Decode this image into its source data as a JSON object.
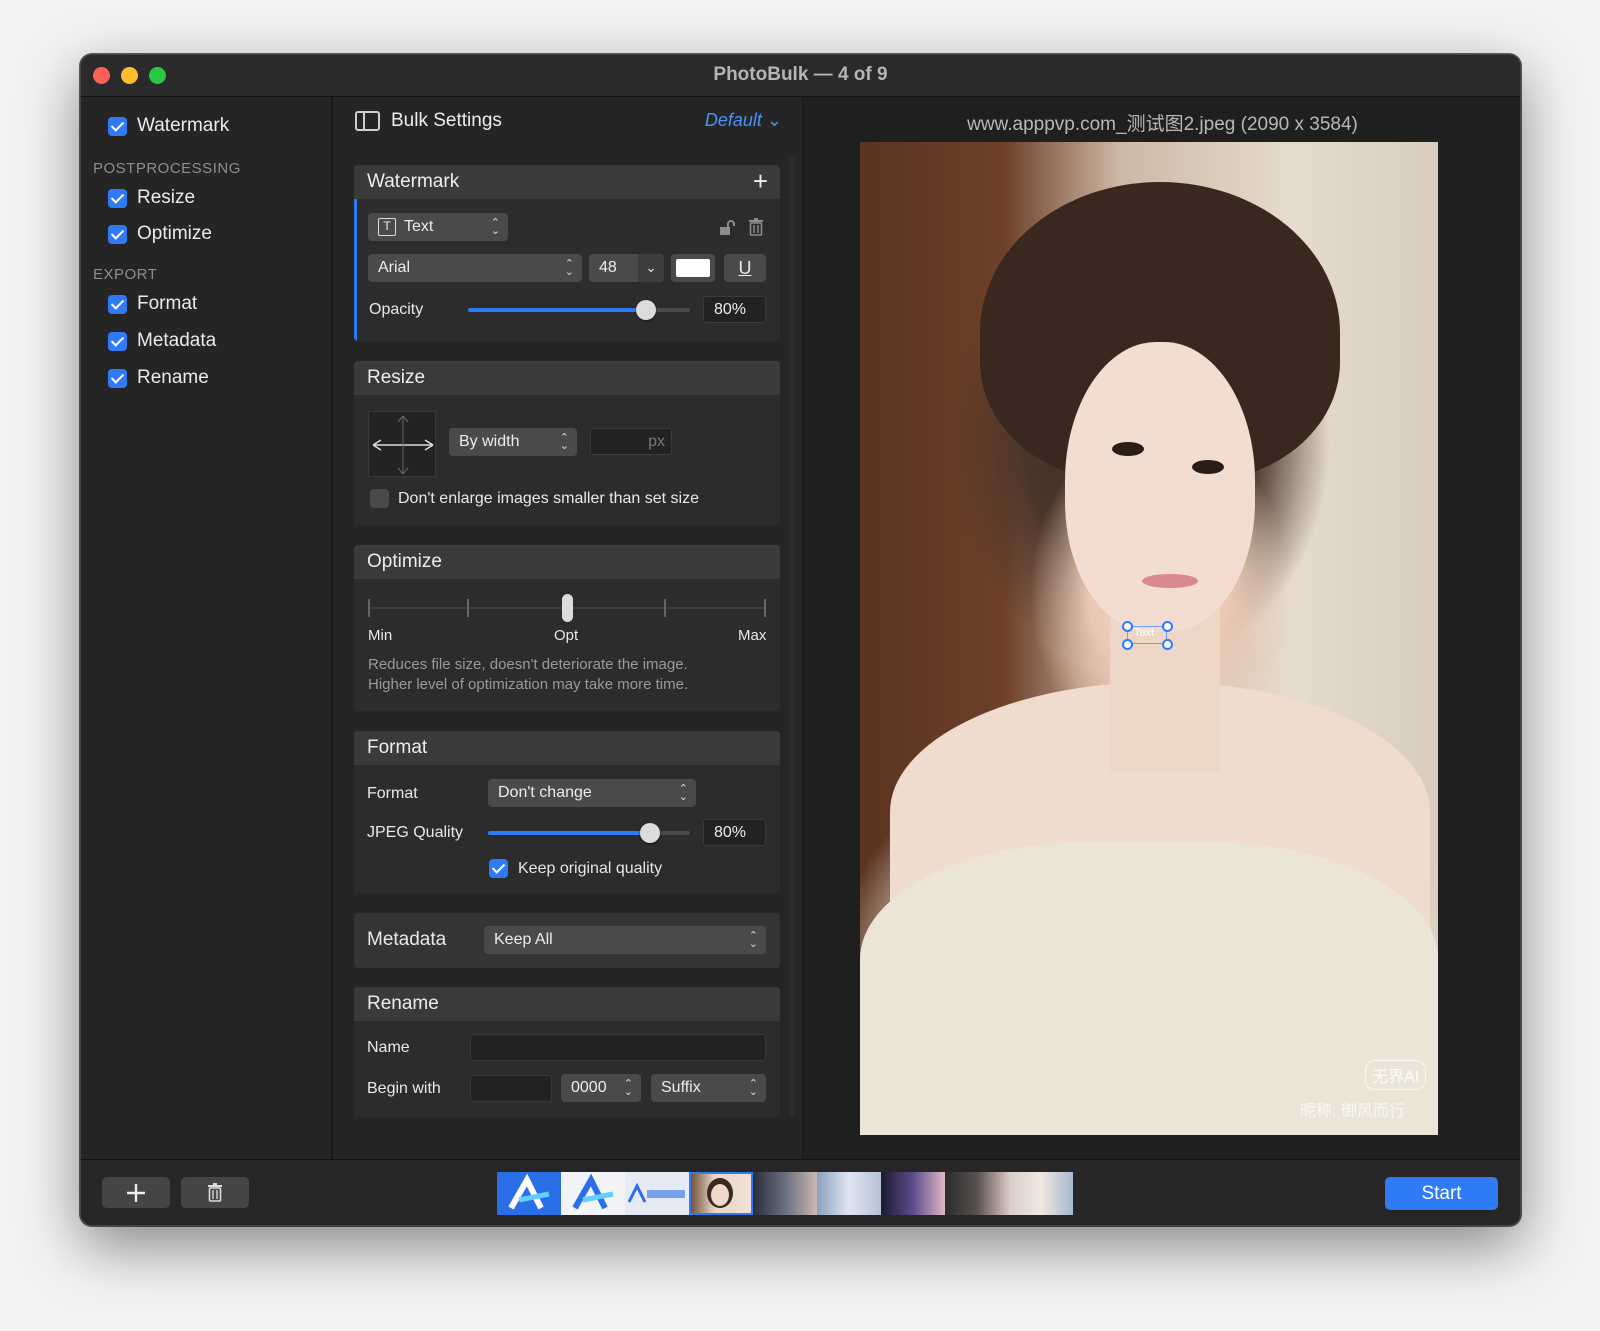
{
  "window": {
    "title": "PhotoBulk — 4 of 9"
  },
  "sidebar": {
    "top_item": {
      "label": "Watermark",
      "checked": true
    },
    "sections": [
      {
        "title": "POSTPROCESSING",
        "items": [
          {
            "label": "Resize",
            "checked": true
          },
          {
            "label": "Optimize",
            "checked": true
          }
        ]
      },
      {
        "title": "EXPORT",
        "items": [
          {
            "label": "Format",
            "checked": true
          },
          {
            "label": "Metadata",
            "checked": true
          },
          {
            "label": "Rename",
            "checked": true
          }
        ]
      }
    ]
  },
  "settings": {
    "title": "Bulk Settings",
    "preset": "Default",
    "watermark": {
      "header": "Watermark",
      "type": "Text",
      "font": "Arial",
      "size": "48",
      "color": "#ffffff",
      "underline": "U",
      "opacity_label": "Opacity",
      "opacity_value": "80%",
      "opacity_fraction": 0.8
    },
    "resize": {
      "header": "Resize",
      "mode": "By width",
      "unit": "px",
      "width_value": "",
      "dont_enlarge_label": "Don't enlarge images smaller than set size",
      "dont_enlarge_checked": false
    },
    "optimize": {
      "header": "Optimize",
      "labels": {
        "min": "Min",
        "opt": "Opt",
        "max": "Max"
      },
      "level_fraction": 0.5,
      "description_line1": "Reduces file size, doesn't deteriorate the image.",
      "description_line2": "Higher level of optimization may take more time."
    },
    "format": {
      "header": "Format",
      "format_label": "Format",
      "format_value": "Don't change",
      "quality_label": "JPEG Quality",
      "quality_value": "80%",
      "quality_fraction": 0.8,
      "keep_original_label": "Keep original quality",
      "keep_original_checked": true
    },
    "metadata": {
      "header": "Metadata",
      "value": "Keep All"
    },
    "rename": {
      "header": "Rename",
      "name_label": "Name",
      "name_value": "",
      "begin_label": "Begin with",
      "begin_value": "",
      "counter": "0000",
      "position": "Suffix"
    }
  },
  "preview": {
    "filename": "www.apppvp.com_测试图2.jpeg (2090 x 3584)",
    "watermark_text": "Text",
    "corner_badge": "无界AI",
    "corner_caption": "昵称: 御风而行"
  },
  "bottombar": {
    "start_label": "Start",
    "thumbnails_count": 9,
    "selected_index": 3
  },
  "colors": {
    "accent": "#2f7bf6",
    "window_bg": "#1f1f1f",
    "panel_bg": "#2c2c2c"
  }
}
